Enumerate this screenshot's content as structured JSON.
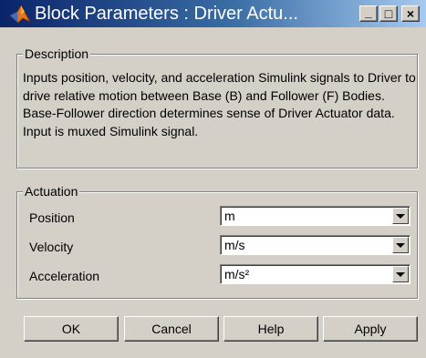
{
  "window": {
    "title": "Block Parameters : Driver Actu...",
    "controls": {
      "minimize": "_",
      "maximize": "□",
      "close": "×"
    }
  },
  "description": {
    "legend": "Description",
    "text": "Inputs position, velocity, and acceleration Simulink signals to Driver to drive relative motion between Base (B) and Follower (F) Bodies. Base-Follower direction determines sense of Driver Actuator data. Input is muxed Simulink signal."
  },
  "actuation": {
    "legend": "Actuation",
    "fields": [
      {
        "label": "Position",
        "value": "m"
      },
      {
        "label": "Velocity",
        "value": "m/s"
      },
      {
        "label": "Acceleration",
        "value": "m/s²"
      }
    ]
  },
  "buttons": {
    "ok": "OK",
    "cancel": "Cancel",
    "help": "Help",
    "apply": "Apply"
  },
  "icons": {
    "app": "matlab-logo-icon",
    "dropdown": "chevron-down-icon"
  },
  "colors": {
    "title_start": "#0a246a",
    "title_end": "#a6caf0",
    "face": "#d4d0c8"
  }
}
